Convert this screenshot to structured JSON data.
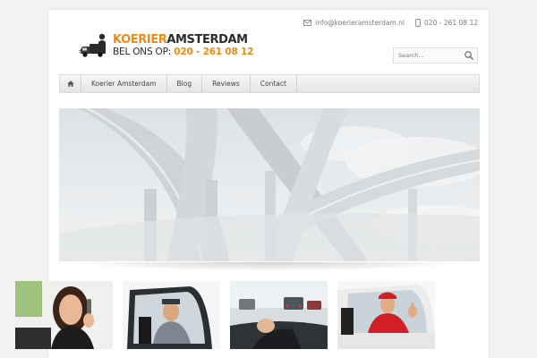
{
  "header": {
    "email": "info@koerieramsterdam.nl",
    "phone": "020 - 261 08 12",
    "logo": {
      "brand_orange": "KOERIER",
      "brand_dark": "AMSTERDAM",
      "tagline_prefix": "BEL ONS OP:",
      "tagline_number": "020 - 261 08 12"
    },
    "search_placeholder": "Search..."
  },
  "nav": {
    "home_icon": "home-icon",
    "items": [
      {
        "label": "Koerier Amsterdam"
      },
      {
        "label": "Blog"
      },
      {
        "label": "Reviews"
      },
      {
        "label": "Contact"
      }
    ]
  },
  "colors": {
    "accent": "#ef8a12",
    "text": "#2b2b2b",
    "background": "#f2f2f2"
  },
  "thumbnails": [
    {
      "icon": "woman-phone-photo"
    },
    {
      "icon": "van-driver-photo"
    },
    {
      "icon": "traffic-photo"
    },
    {
      "icon": "courier-thumbs-up-photo"
    }
  ]
}
